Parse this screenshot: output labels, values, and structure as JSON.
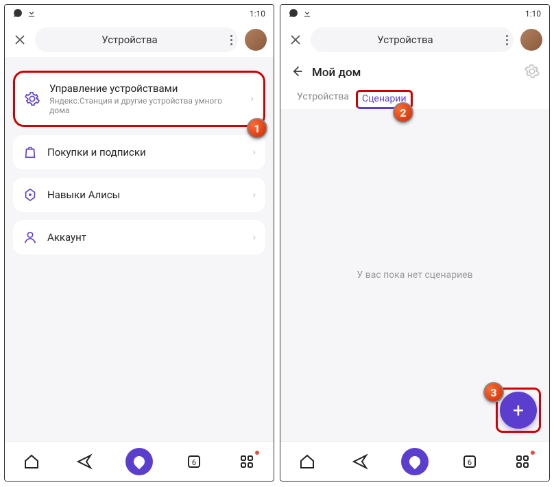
{
  "status": {
    "time": "1:10"
  },
  "screen1": {
    "header_title": "Устройства",
    "items": [
      {
        "title": "Управление устройствами",
        "subtitle": "Яндекс.Станция и другие устройства умного дома"
      },
      {
        "title": "Покупки и подписки"
      },
      {
        "title": "Навыки Алисы"
      },
      {
        "title": "Аккаунт"
      }
    ],
    "badge": "1"
  },
  "screen2": {
    "header_title": "Устройства",
    "page_title": "Мой дом",
    "tabs": {
      "devices": "Устройства",
      "scenarios": "Сценарии"
    },
    "empty": "У вас пока нет сценариев",
    "badge_tab": "2",
    "badge_fab": "3"
  },
  "nav": {
    "tab_count": "6"
  }
}
